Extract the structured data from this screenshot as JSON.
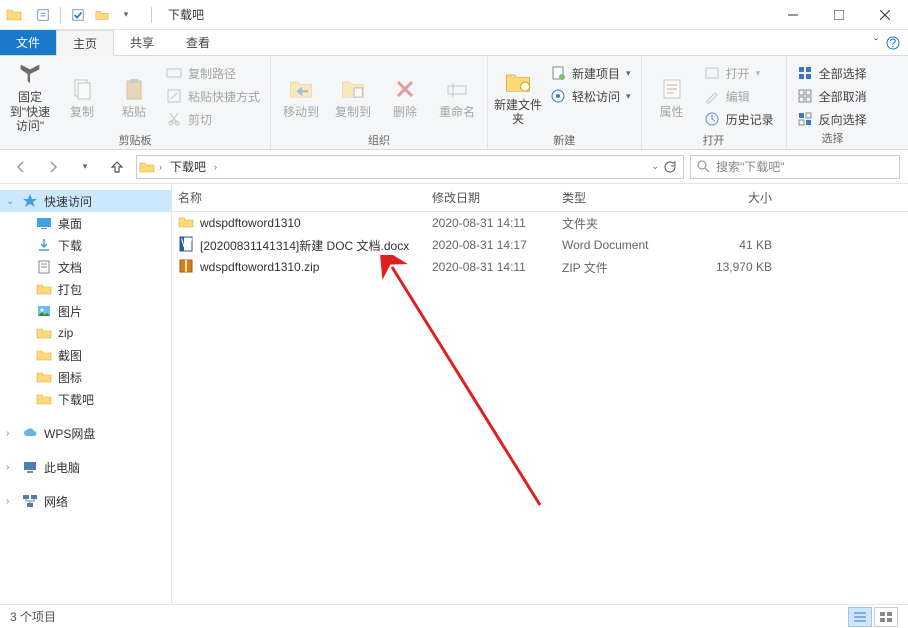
{
  "window": {
    "title": "下载吧",
    "tabs": {
      "file": "文件",
      "home": "主页",
      "share": "共享",
      "view": "查看"
    }
  },
  "ribbon": {
    "clipboard": {
      "label": "剪贴板",
      "pin": "固定到\"快速访问\"",
      "copy": "复制",
      "paste": "粘贴",
      "copyPath": "复制路径",
      "pasteShortcut": "粘贴快捷方式",
      "cut": "剪切"
    },
    "organize": {
      "label": "组织",
      "moveTo": "移动到",
      "copyTo": "复制到",
      "delete": "删除",
      "rename": "重命名"
    },
    "newGroup": {
      "label": "新建",
      "newFolder": "新建文件夹",
      "newItem": "新建项目",
      "easyAccess": "轻松访问"
    },
    "open": {
      "label": "打开",
      "properties": "属性",
      "open": "打开",
      "edit": "编辑",
      "history": "历史记录"
    },
    "select": {
      "label": "选择",
      "selectAll": "全部选择",
      "selectNone": "全部取消",
      "invert": "反向选择"
    }
  },
  "address": {
    "crumb1": "下载吧",
    "searchPlaceholder": "搜索\"下载吧\""
  },
  "sidebar": {
    "quickAccess": "快速访问",
    "items": [
      "桌面",
      "下载",
      "文档",
      "打包",
      "图片",
      "zip",
      "截图",
      "图标",
      "下载吧"
    ],
    "wps": "WPS网盘",
    "thisPC": "此电脑",
    "network": "网络"
  },
  "columns": {
    "name": "名称",
    "date": "修改日期",
    "type": "类型",
    "size": "大小"
  },
  "files": [
    {
      "icon": "folder",
      "name": "wdspdftoword1310",
      "date": "2020-08-31 14:11",
      "type": "文件夹",
      "size": ""
    },
    {
      "icon": "docx",
      "name": "[20200831141314]新建 DOC 文档.docx",
      "date": "2020-08-31 14:17",
      "type": "Word Document",
      "size": "41 KB"
    },
    {
      "icon": "zip",
      "name": "wdspdftoword1310.zip",
      "date": "2020-08-31 14:11",
      "type": "ZIP 文件",
      "size": "13,970 KB"
    }
  ],
  "status": {
    "count": "3 个项目"
  }
}
